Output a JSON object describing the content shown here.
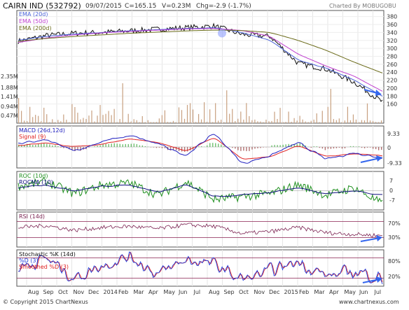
{
  "header": {
    "ticker": "CAIRN IND (532792)",
    "date": "09/07/2015",
    "close": "C=165.15",
    "volume": "V=0.23M",
    "change": "Chg=-2.9 (-1.7%)",
    "charted_by": "Charted By MOBUGOBU"
  },
  "footer": {
    "copyright": "© Copyright 2015 ChartNexus",
    "website": "www.chartnexus.com"
  },
  "x_axis": {
    "labels": [
      "Aug",
      "Sep",
      "Oct",
      "Nov",
      "Dec",
      "2014",
      "Feb",
      "Mar",
      "Apr",
      "May",
      "Jun",
      "Jul",
      "Aug",
      "Sep",
      "Oct",
      "Nov",
      "Dec",
      "2015",
      "Feb",
      "Mar",
      "Apr",
      "May",
      "Jun",
      "Jul"
    ]
  },
  "colors": {
    "price": "#111111",
    "ema20": "#4a63d8",
    "ema50": "#c040d0",
    "ema200": "#6b6b1a",
    "macd": "#2020c0",
    "signal": "#e02020",
    "hist_pos": "#6fbf6f",
    "hist_neg": "#b07070",
    "roc": "#209020",
    "rocma": "#101080",
    "rsi": "#7a2050",
    "stoch_k": "#2040e0",
    "stoch_d": "#e02020",
    "arrow": "#3366ee",
    "guide": "#8a2050",
    "volume": "#c8a080"
  },
  "chart_data": [
    {
      "type": "line",
      "panel": "price",
      "legend": [
        "EMA (20d)",
        "EMA (50d)",
        "EMA (200d)"
      ],
      "y_ticks": [
        160,
        180,
        200,
        220,
        240,
        260,
        280,
        300,
        320,
        340,
        360,
        380
      ],
      "ylim": [
        140,
        390
      ],
      "x": [
        0,
        2,
        4,
        6,
        8,
        10,
        12,
        14,
        16,
        18,
        20,
        22,
        24
      ],
      "series": [
        {
          "name": "price",
          "values": [
            318,
            332,
            338,
            340,
            344,
            348,
            352,
            356,
            335,
            330,
            262,
            248,
            215,
            165
          ]
        },
        {
          "name": "EMA (20d)",
          "values": [
            320,
            330,
            336,
            340,
            344,
            347,
            350,
            352,
            340,
            320,
            270,
            250,
            220,
            180
          ]
        },
        {
          "name": "EMA (50d)",
          "values": [
            315,
            326,
            334,
            339,
            343,
            346,
            349,
            350,
            345,
            330,
            285,
            255,
            230,
            192
          ]
        },
        {
          "name": "EMA (200d)",
          "values": [
            318,
            325,
            330,
            334,
            338,
            341,
            344,
            346,
            345,
            340,
            320,
            295,
            265,
            238
          ]
        }
      ]
    },
    {
      "type": "bar",
      "panel": "volume",
      "y_ticks": [
        "2.35M",
        "1.88M",
        "1.41M",
        "0.94M",
        "0.47M"
      ],
      "ylim": [
        0,
        2.6
      ]
    },
    {
      "type": "line",
      "panel": "macd",
      "legend": [
        "MACD (26d,12d)",
        "Signal (9)"
      ],
      "y_ticks": [
        "9.33",
        "0",
        "-9.33"
      ],
      "ylim": [
        -14,
        14
      ],
      "series": [
        {
          "name": "MACD (26d,12d)",
          "values": [
            2,
            5,
            -3,
            4,
            8,
            2,
            -6,
            10,
            -12,
            -6,
            3,
            -9,
            -4,
            -8
          ]
        },
        {
          "name": "Signal (9)",
          "values": [
            1,
            3,
            0,
            2,
            6,
            3,
            -3,
            7,
            -9,
            -7,
            1,
            -7,
            -5,
            -6
          ]
        }
      ]
    },
    {
      "type": "line",
      "panel": "roc",
      "legend": [
        "ROC (10d)",
        "ROCMA (10)"
      ],
      "y_ticks": [
        "7",
        "0",
        "-7"
      ],
      "ylim": [
        -12,
        12
      ],
      "series": [
        {
          "name": "ROC (10d)",
          "values": [
            3,
            6,
            -2,
            4,
            5,
            -3,
            6,
            -6,
            -4,
            -2,
            4,
            -3,
            2,
            -9
          ]
        },
        {
          "name": "ROCMA (10)",
          "values": [
            2,
            4,
            0,
            3,
            4,
            -1,
            4,
            -4,
            -3,
            -1,
            2,
            -2,
            0,
            -3
          ]
        }
      ]
    },
    {
      "type": "line",
      "panel": "rsi",
      "legend": [
        "RSI (14d)"
      ],
      "y_ticks": [
        "70%",
        "30%"
      ],
      "ylim": [
        10,
        90
      ],
      "series": [
        {
          "name": "RSI (14d)",
          "values": [
            55,
            60,
            48,
            55,
            58,
            52,
            62,
            58,
            40,
            45,
            55,
            42,
            38,
            35
          ]
        }
      ]
    },
    {
      "type": "line",
      "panel": "stochastic",
      "legend": [
        "Stochastic %K (14d)",
        "%D (3)",
        "Smoothed %D (3)"
      ],
      "y_ticks": [
        "80%",
        "20%"
      ],
      "ylim": [
        0,
        100
      ],
      "series": [
        {
          "name": "%D (3)",
          "values": [
            50,
            80,
            20,
            60,
            85,
            30,
            75,
            60,
            15,
            40,
            70,
            25,
            40,
            20
          ]
        },
        {
          "name": "Smoothed %D (3)",
          "values": [
            48,
            75,
            25,
            55,
            80,
            35,
            70,
            62,
            20,
            38,
            65,
            30,
            38,
            25
          ]
        }
      ]
    }
  ]
}
